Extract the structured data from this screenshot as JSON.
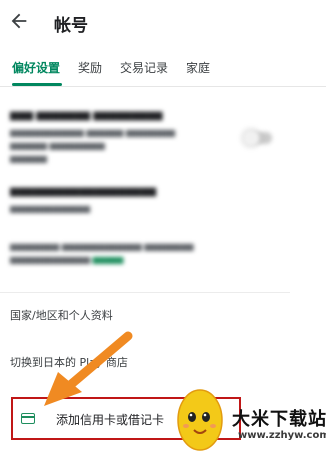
{
  "appbar": {
    "title": "帐号",
    "back_icon": "arrow-left-icon"
  },
  "tabs": [
    {
      "label": "偏好设置",
      "active": true
    },
    {
      "label": "奖励",
      "active": false
    },
    {
      "label": "交易记录",
      "active": false
    },
    {
      "label": "家庭",
      "active": false
    }
  ],
  "colors": {
    "accent": "#01875f",
    "highlight_box": "#c01717",
    "arrow": "#f08a22"
  },
  "menu": {
    "country_profile": "国家/地区和个人资料",
    "switch_store": "切换到日本的 Play 商店",
    "add_card": "添加信用卡或借记卡",
    "add_card_icon": "credit-card-icon"
  },
  "watermark": {
    "title": "大米下载站",
    "url": "www.zzhyw.com"
  }
}
